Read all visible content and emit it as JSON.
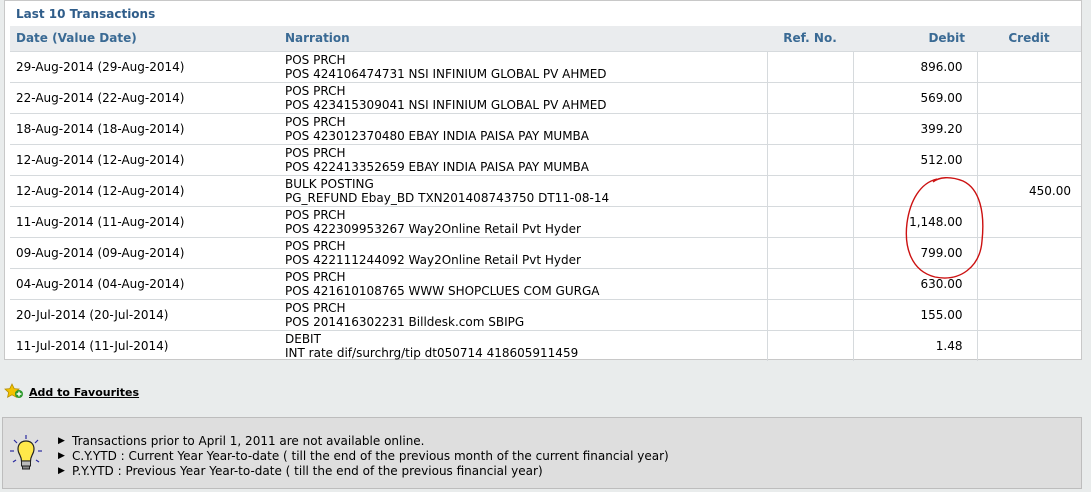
{
  "panel": {
    "title": "Last 10 Transactions",
    "columns": {
      "date": "Date (Value Date)",
      "narration": "Narration",
      "ref": "Ref. No.",
      "debit": "Debit",
      "credit": "Credit"
    },
    "rows": [
      {
        "date": "29-Aug-2014 (29-Aug-2014)",
        "narr1": "POS PRCH",
        "narr2": "POS 424106474731 NSI INFINIUM GLOBAL PV AHMED",
        "ref": "",
        "debit": "896.00",
        "credit": ""
      },
      {
        "date": "22-Aug-2014 (22-Aug-2014)",
        "narr1": "POS PRCH",
        "narr2": "POS 423415309041 NSI INFINIUM GLOBAL PV AHMED",
        "ref": "",
        "debit": "569.00",
        "credit": ""
      },
      {
        "date": "18-Aug-2014 (18-Aug-2014)",
        "narr1": "POS PRCH",
        "narr2": "POS 423012370480 EBAY INDIA PAISA PAY MUMBA",
        "ref": "",
        "debit": "399.20",
        "credit": ""
      },
      {
        "date": "12-Aug-2014 (12-Aug-2014)",
        "narr1": "POS PRCH",
        "narr2": "POS 422413352659 EBAY INDIA PAISA PAY MUMBA",
        "ref": "",
        "debit": "512.00",
        "credit": ""
      },
      {
        "date": "12-Aug-2014 (12-Aug-2014)",
        "narr1": "BULK POSTING",
        "narr2": "PG_REFUND Ebay_BD TXN201408743750 DT11-08-14",
        "ref": "",
        "debit": "",
        "credit": "450.00"
      },
      {
        "date": "11-Aug-2014 (11-Aug-2014)",
        "narr1": "POS PRCH",
        "narr2": "POS 422309953267 Way2Online Retail Pvt Hyder",
        "ref": "",
        "debit": "1,148.00",
        "credit": ""
      },
      {
        "date": "09-Aug-2014 (09-Aug-2014)",
        "narr1": "POS PRCH",
        "narr2": "POS 422111244092 Way2Online Retail Pvt Hyder",
        "ref": "",
        "debit": "799.00",
        "credit": ""
      },
      {
        "date": "04-Aug-2014 (04-Aug-2014)",
        "narr1": "POS PRCH",
        "narr2": "POS 421610108765 WWW SHOPCLUES COM GURGA",
        "ref": "",
        "debit": "630.00",
        "credit": ""
      },
      {
        "date": "20-Jul-2014 (20-Jul-2014)",
        "narr1": "POS PRCH",
        "narr2": "POS 201416302231 Billdesk.com SBIPG",
        "ref": "",
        "debit": "155.00",
        "credit": ""
      },
      {
        "date": "11-Jul-2014 (11-Jul-2014)",
        "narr1": "DEBIT",
        "narr2": "INT rate dif/surchrg/tip dt050714 418605911459",
        "ref": "",
        "debit": "1.48",
        "credit": ""
      }
    ]
  },
  "favourites": {
    "label": "Add to Favourites",
    "icon": "star-add-icon"
  },
  "info": {
    "icon": "lightbulb-icon",
    "notes": [
      "Transactions prior to April 1, 2011 are not available online.",
      "C.Y.YTD : Current Year Year-to-date ( till the end of the previous month of the current financial year)",
      "P.Y.YTD : Previous Year Year-to-date ( till the end of the previous financial year)"
    ]
  },
  "colors": {
    "header_text": "#3a6a94",
    "title_text": "#2f5d8a",
    "annotation": "#cc1111"
  }
}
